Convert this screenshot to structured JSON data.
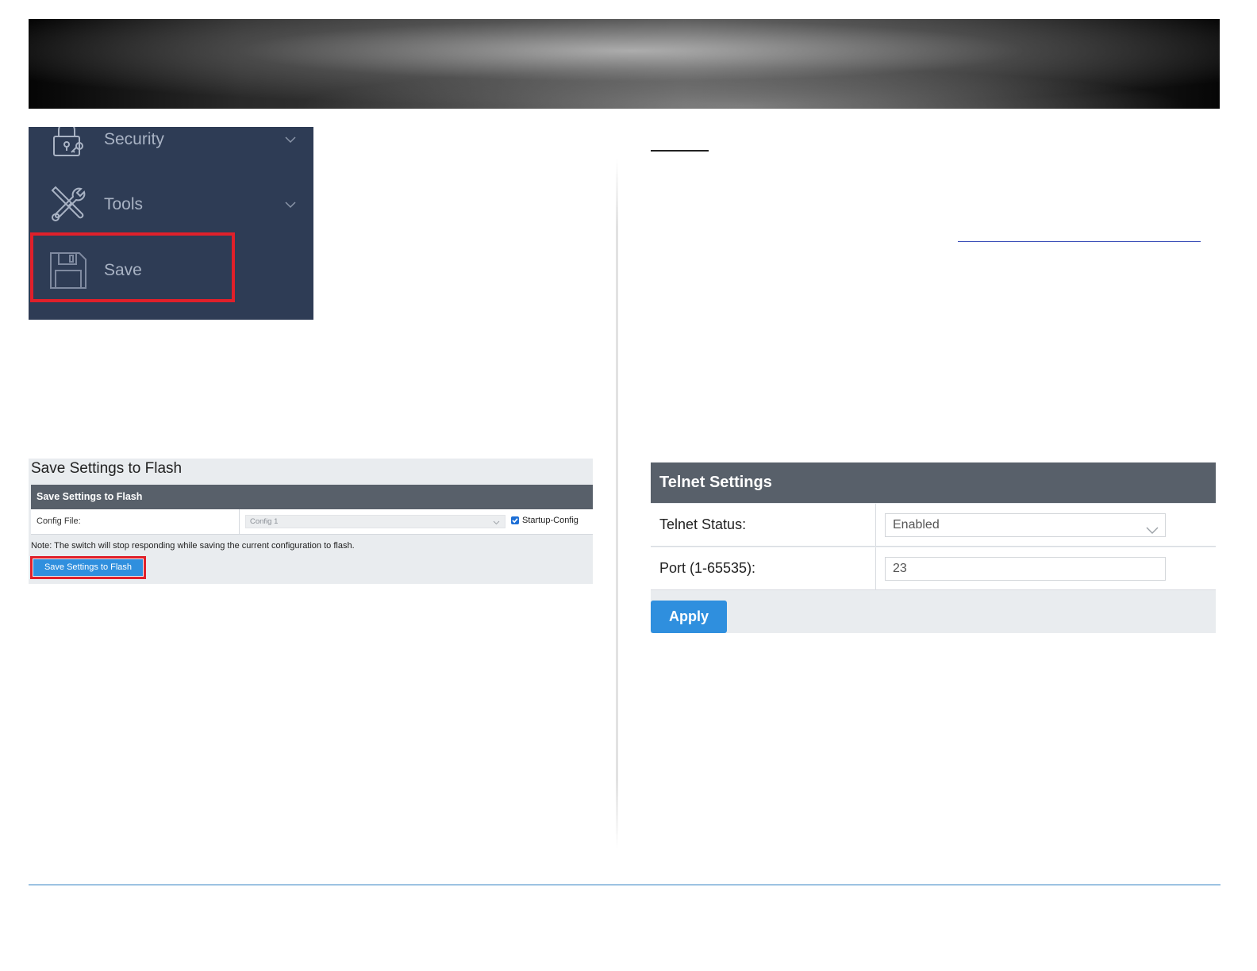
{
  "sidebar": {
    "items": [
      {
        "label": "Security",
        "icon": "lock-icon"
      },
      {
        "label": "Tools",
        "icon": "tools-icon"
      },
      {
        "label": "Save",
        "icon": "floppy-disk-icon"
      }
    ]
  },
  "flash": {
    "title": "Save Settings to Flash",
    "header": "Save Settings to Flash",
    "config_label": "Config File:",
    "config_value": "Config 1",
    "startup_label": "Startup-Config",
    "startup_checked": true,
    "note": "Note: The switch will stop responding while saving the current configuration to flash.",
    "button_label": "Save Settings to Flash"
  },
  "telnet": {
    "header": "Telnet Settings",
    "status_label": "Telnet Status:",
    "status_value": "Enabled",
    "port_label": "Port (1-65535):",
    "port_value": "23",
    "apply_label": "Apply"
  },
  "colors": {
    "sidebar_bg": "#2e3c55",
    "highlight": "#e0202a",
    "button_blue": "#2f8fde",
    "panel_header": "#58606a"
  }
}
